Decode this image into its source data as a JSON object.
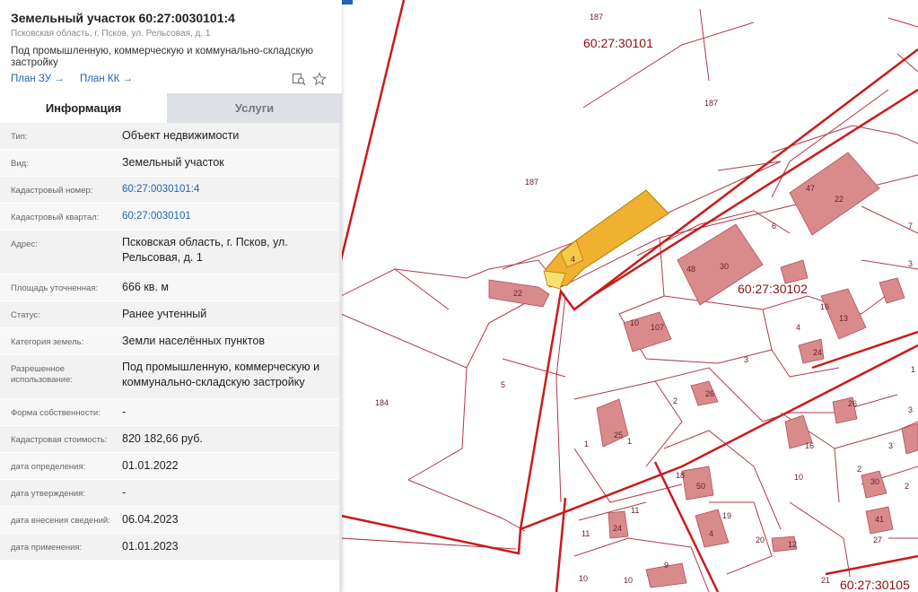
{
  "parcel": {
    "title": "Земельный участок 60:27:0030101:4",
    "address_line": "Псковская область, г. Псков, ул. Рельсовая, д. 1",
    "purpose": "Под промышленную, коммерческую и коммунально-складскую застройку",
    "links": [
      "План ЗУ →",
      "План КК →"
    ],
    "icons": [
      "map-search-icon",
      "star-icon"
    ]
  },
  "tabs": [
    {
      "label": "Информация",
      "active": true
    },
    {
      "label": "Услуги",
      "active": false
    }
  ],
  "fields": [
    {
      "label": "Тип:",
      "value": "Объект недвижимости"
    },
    {
      "label": "Вид:",
      "value": "Земельный участок"
    },
    {
      "label": "Кадастровый номер:",
      "value": "60:27:0030101:4",
      "link": true
    },
    {
      "label": "Кадастровый квартал:",
      "value": "60:27:0030101",
      "link": true
    },
    {
      "label": "Адрес:",
      "value": "Псковская область, г. Псков, ул. Рельсовая, д. 1"
    },
    {
      "label": "Площадь уточненная:",
      "value": "666 кв. м"
    },
    {
      "label": "Статус:",
      "value": "Ранее учтенный"
    },
    {
      "label": "Категория земель:",
      "value": "Земли населённых пунктов"
    },
    {
      "label": "Разрешенное использование:",
      "value": "Под промышленную, коммерческую и коммунально-складскую застройку"
    },
    {
      "label": "Форма собственности:",
      "value": "-"
    },
    {
      "label": "Кадастровая стоимость:",
      "value": "820 182,66 руб."
    },
    {
      "label": "дата определения:",
      "value": "01.01.2022"
    },
    {
      "label": "дата утверждения:",
      "value": "-"
    },
    {
      "label": "дата внесения сведений:",
      "value": "06.04.2023"
    },
    {
      "label": "дата применения:",
      "value": "01.01.2023"
    }
  ],
  "map": {
    "quarter_labels": [
      "60:27:30101",
      "60:27:30102",
      "60:27:30105"
    ],
    "parcel_numbers": [
      "187",
      "187",
      "187",
      "184",
      "5",
      "22",
      "4",
      "10",
      "107",
      "48",
      "30",
      "47",
      "22",
      "3",
      "3",
      "16",
      "13",
      "4",
      "24",
      "2",
      "26",
      "1",
      "1",
      "25",
      "16",
      "3",
      "7",
      "2",
      "10",
      "18",
      "50",
      "19",
      "11",
      "11",
      "24",
      "20",
      "4",
      "21",
      "27",
      "10",
      "10",
      "9",
      "2",
      "30",
      "12",
      "3",
      "1",
      "6",
      "41",
      "26"
    ],
    "colors": {
      "boundary": "#cc1a1a",
      "line": "#b03a4a",
      "building": "#d98a8a",
      "selected": "#f0b030"
    }
  }
}
